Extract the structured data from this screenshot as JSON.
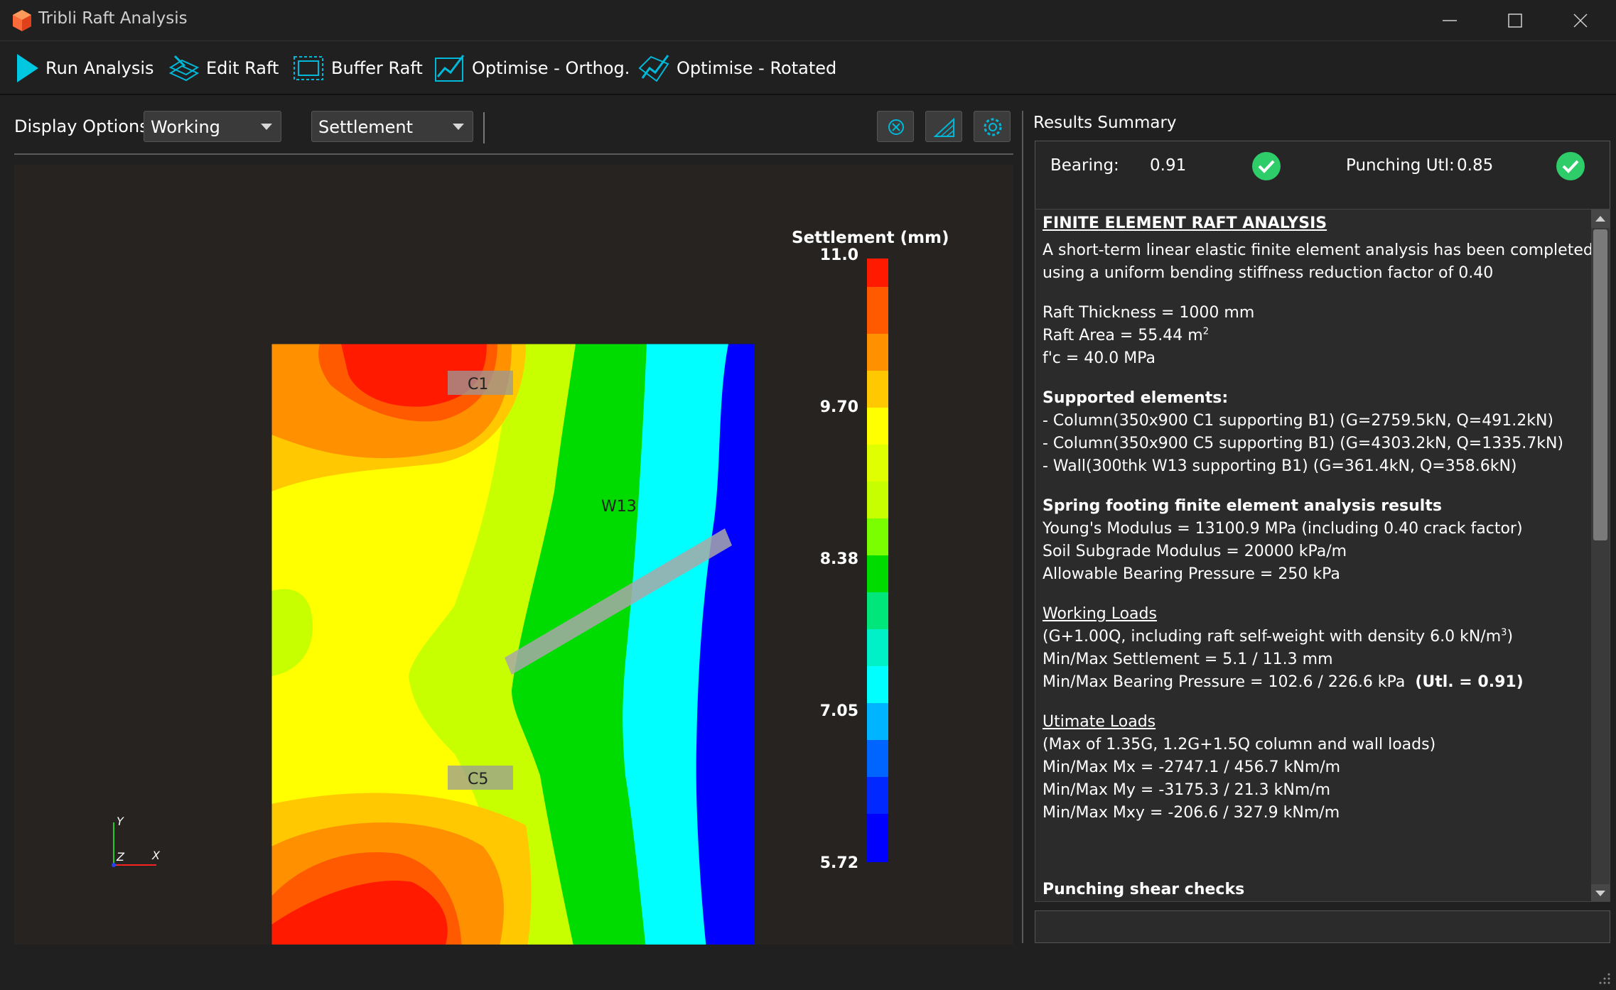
{
  "window": {
    "title": "Tribli Raft Analysis",
    "icons": {
      "app": "app-logo-icon",
      "minimize": "minimize-icon",
      "maximize": "maximize-icon",
      "close": "close-icon"
    }
  },
  "toolbar": {
    "run_label": "Run Analysis",
    "edit_label": "Edit Raft",
    "buffer_label": "Buffer Raft",
    "optimise_orthog_label": "Optimise - Orthog.",
    "optimise_rotated_label": "Optimise - Rotated"
  },
  "display": {
    "label": "Display Options",
    "load_case": "Working",
    "result_type": "Settlement",
    "icon_buttons": [
      "reset-view-icon",
      "mesh-toggle-icon",
      "settings-gear-icon"
    ]
  },
  "plot": {
    "legend_title": "Settlement (mm)",
    "legend_ticks": [
      "11.0",
      "9.70",
      "8.38",
      "7.05",
      "5.72"
    ],
    "element_labels": {
      "c1": "C1",
      "c5": "C5",
      "w13": "W13"
    },
    "axes": {
      "y": "Y",
      "z": "Z",
      "x": "X"
    },
    "colors": {
      "red": "#ff1a00",
      "orange_red": "#ff5a00",
      "orange": "#ff9000",
      "yellow_orange": "#ffc800",
      "yellow": "#ffff00",
      "yellow_green": "#c8ff00",
      "green": "#00dc00",
      "cyan": "#00ffff",
      "blue": "#0000ff"
    }
  },
  "summary": {
    "title": "Results Summary",
    "bearing_label": "Bearing:",
    "bearing_value": "0.91",
    "punching_label": "Punching Utl:",
    "punching_value": "0.85",
    "status_color": "#2fcc6a"
  },
  "report": {
    "heading": "FINITE ELEMENT RAFT ANALYSIS",
    "intro_1": "A short-term linear elastic finite element analysis has been completed",
    "intro_2": "using a uniform bending stiffness reduction factor of 0.40",
    "thickness": "Raft Thickness = 1000 mm",
    "area": "Raft Area = 55.44 m",
    "area_sup": "2",
    "fc": "f'c = 40.0 MPa",
    "supported_heading": "Supported elements:",
    "supported": [
      "- Column(350x900 C1 supporting B1) (G=2759.5kN, Q=491.2kN)",
      "- Column(350x900 C5 supporting B1) (G=4303.2kN, Q=1335.7kN)",
      "- Wall(300thk W13 supporting B1) (G=361.4kN, Q=358.6kN)"
    ],
    "spring_heading": "Spring footing finite element analysis results",
    "youngs": "Young's Modulus = 13100.9 MPa (including 0.40 crack factor)",
    "subgrade": "Soil Subgrade Modulus = 20000 kPa/m",
    "allowable": "Allowable Bearing Pressure = 250 kPa",
    "working_heading": "Working Loads",
    "working_1": "(G+1.00Q, including raft self-weight with density 6.0 kN/m",
    "working_1_sup": "3",
    "working_1_end": ")",
    "working_2": "Min/Max Settlement = 5.1 / 11.3 mm",
    "working_3": "Min/Max Bearing Pressure = 102.6 / 226.6 kPa",
    "working_3_util": "(Utl. = 0.91)",
    "ultimate_heading": "Utimate Loads",
    "ultimate_1": "(Max of 1.35G, 1.2G+1.5Q column and wall loads)",
    "ultimate_2": "Min/Max Mx = -2747.1 / 456.7 kNm/m",
    "ultimate_3": "Min/Max My = -3175.3 / 21.3 kNm/m",
    "ultimate_4": "Min/Max Mxy = -206.6 / 327.9 kNm/m",
    "punching_heading": "Punching shear checks"
  }
}
